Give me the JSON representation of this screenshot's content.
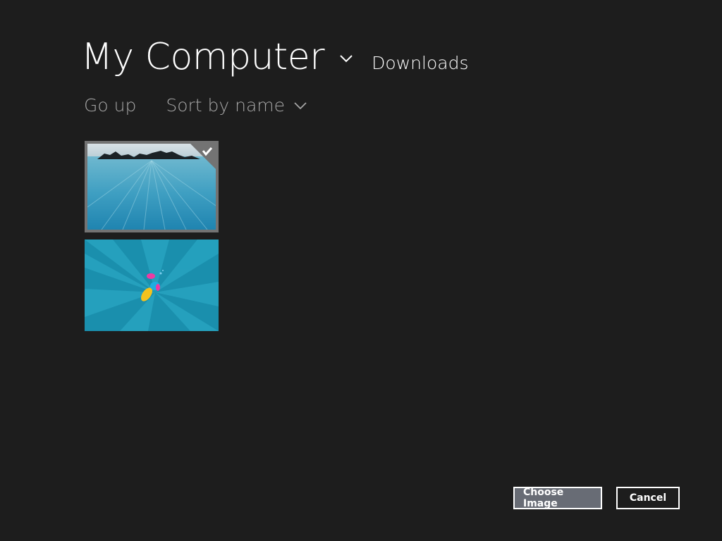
{
  "header": {
    "location": "My Computer",
    "location_icon": "chevron-down-icon",
    "subfolder": "Downloads"
  },
  "toolbar": {
    "go_up": "Go up",
    "sort": "Sort by name",
    "sort_icon": "chevron-down-icon"
  },
  "files": [
    {
      "thumbnail": "seascape-rocks",
      "selected": true,
      "check_icon": "checkmark-icon"
    },
    {
      "thumbnail": "teal-rays-fish",
      "selected": false
    }
  ],
  "buttons": {
    "choose": "Choose Image",
    "cancel": "Cancel"
  },
  "colors": {
    "background": "#1d1d1d",
    "selection_border": "#737373",
    "primary_button": "#686c75",
    "secondary_text": "#a6a6a6"
  }
}
